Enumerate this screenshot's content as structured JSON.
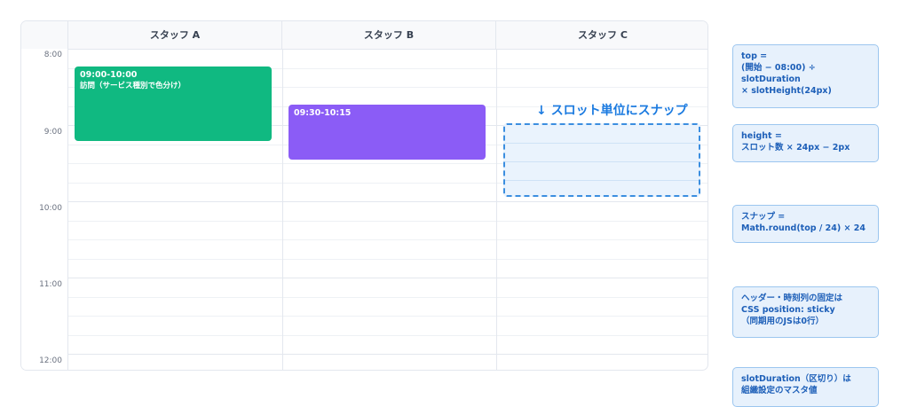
{
  "columns": [
    {
      "label": "スタッフ A"
    },
    {
      "label": "スタッフ B"
    },
    {
      "label": "スタッフ C"
    }
  ],
  "times": [
    "8:00",
    "9:00",
    "10:00",
    "11:00",
    "12:00"
  ],
  "events": [
    {
      "column": 0,
      "time": "09:00-10:00",
      "subtitle": "訪問（サービス種別で色分け）",
      "color": "#10b981"
    },
    {
      "column": 1,
      "time": "09:30-10:15",
      "subtitle": "",
      "color": "#8b5cf6"
    }
  ],
  "snap_label": "↓ スロット単位にスナップ",
  "notes": [
    {
      "text": "top =\n(開始 − 08:00) ÷\nslotDuration\n× slotHeight(24px)"
    },
    {
      "text": "height =\nスロット数 × 24px − 2px"
    },
    {
      "text": "スナップ =\nMath.round(top / 24) × 24"
    },
    {
      "text": "ヘッダー・時刻列の固定は\nCSS position: sticky\n（同期用のJSは0行）"
    },
    {
      "text": "slotDuration（区切り）は\n組織設定のマスタ値"
    }
  ]
}
